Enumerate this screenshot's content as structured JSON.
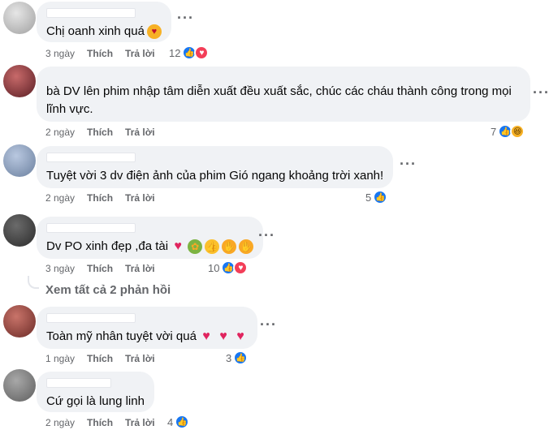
{
  "comments": [
    {
      "text": "Chị oanh xinh quá",
      "time": "3 ngày",
      "like": "Thích",
      "reply": "Trả lời",
      "count": "12",
      "reactions": [
        "like",
        "love"
      ]
    },
    {
      "text_line1": "bà DV lên phim nhập tâm diễn xuất đều xuất sắc, chúc các cháu thành công trong mọi",
      "text_line2": "lĩnh vực.",
      "time": "2 ngày",
      "like": "Thích",
      "reply": "Trả lời",
      "count": "7",
      "reactions": [
        "like",
        "haha"
      ]
    },
    {
      "text": "Tuyệt vời 3 dv điện ảnh của phim Gió ngang khoảng trời xanh!",
      "time": "2 ngày",
      "like": "Thích",
      "reply": "Trả lời",
      "count": "5",
      "reactions": [
        "like"
      ]
    },
    {
      "text": "Dv PO xinh đẹp ,đa tài",
      "time": "3 ngày",
      "like": "Thích",
      "reply": "Trả lời",
      "count": "10",
      "reactions": [
        "like",
        "love"
      ]
    },
    {
      "text": "Toàn mỹ nhân tuyệt vời quá",
      "time": "1 ngày",
      "like": "Thích",
      "reply": "Trả lời",
      "count": "3",
      "reactions": [
        "like"
      ]
    },
    {
      "text": "Cứ gọi là lung linh",
      "time": "2 ngày",
      "like": "Thích",
      "reply": "Trả lời",
      "count": "4",
      "reactions": [
        "like"
      ]
    }
  ],
  "view_replies": "Xem tất cả 2 phản hồi",
  "more_label": "···",
  "colors": {
    "like": "#1877f2",
    "love": "#f33e58",
    "haha": "#f7b125",
    "bubble": "#f0f2f5",
    "meta": "#65676b"
  }
}
